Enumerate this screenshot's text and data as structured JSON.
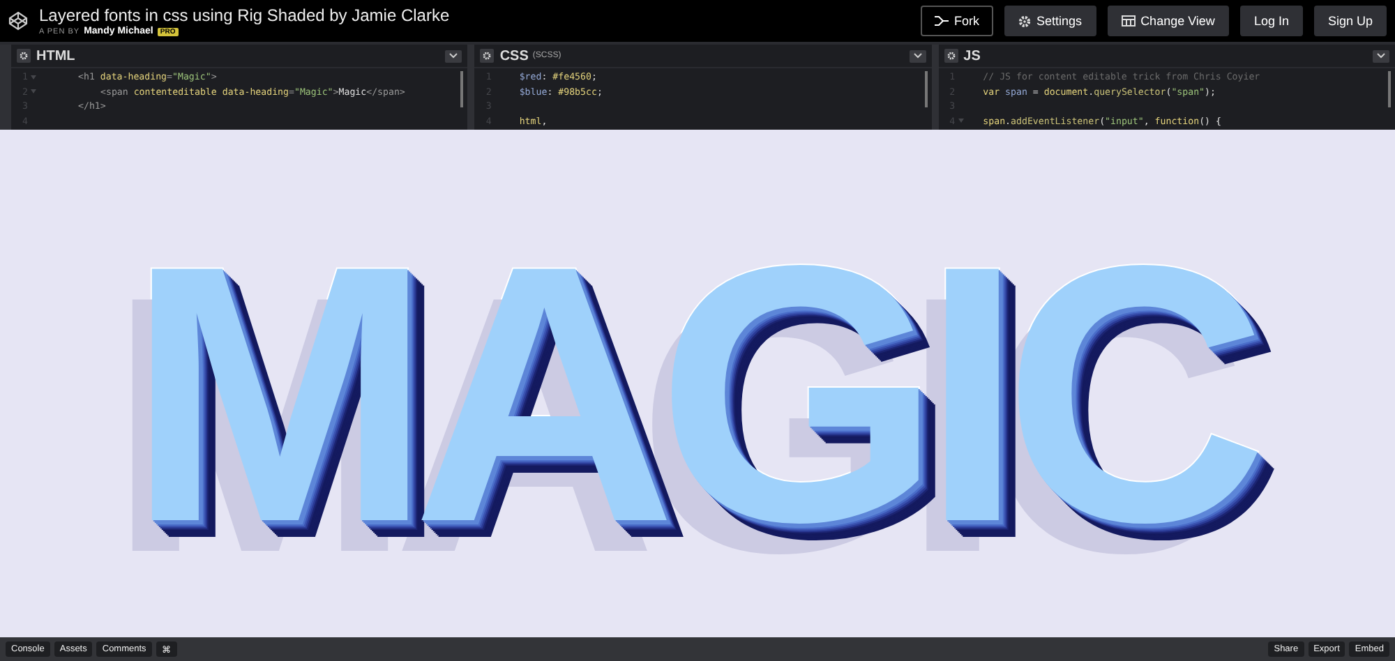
{
  "header": {
    "title": "Layered fonts in css using Rig Shaded by Jamie Clarke",
    "byline": "A PEN BY",
    "author": "Mandy Michael",
    "badge": "PRO",
    "buttons": [
      {
        "label": "Fork",
        "kind": "fork"
      },
      {
        "label": "Settings",
        "kind": "settings"
      },
      {
        "label": "Change View",
        "kind": "view"
      },
      {
        "label": "Log In",
        "kind": "plain"
      },
      {
        "label": "Sign Up",
        "kind": "plain"
      }
    ]
  },
  "editors": [
    {
      "title": "HTML",
      "lines": [
        {
          "number": "1",
          "fold": true,
          "kind": "outer",
          "tokens": [
            {
              "kind": "tag",
              "text": "<h1 "
            },
            {
              "kind": "attr",
              "text": "data-heading"
            },
            {
              "kind": "tag",
              "text": "="
            },
            {
              "kind": "string",
              "text": "\"Magic\""
            },
            {
              "kind": "tag",
              "text": ">"
            }
          ]
        },
        {
          "number": "2",
          "fold": true,
          "kind": "inner",
          "tokens": [
            {
              "kind": "tag",
              "text": "<span "
            },
            {
              "kind": "attr",
              "text": "contenteditable data-heading"
            },
            {
              "kind": "tag",
              "text": "="
            },
            {
              "kind": "string",
              "text": "\"Magic\""
            },
            {
              "kind": "tag",
              "text": ">"
            },
            {
              "kind": "plain",
              "text": "Magic"
            },
            {
              "kind": "tag",
              "text": "</span>"
            }
          ]
        },
        {
          "number": "3",
          "fold": false,
          "kind": "outer",
          "tokens": [
            {
              "kind": "tag",
              "text": "</h1>"
            }
          ]
        },
        {
          "number": "4",
          "fold": false
        }
      ]
    },
    {
      "title": "CSS",
      "subtitle": "(SCSS)",
      "lines": [
        {
          "number": "1",
          "fold": false,
          "kind": "top",
          "tokens": [
            {
              "kind": "var",
              "text": "$red"
            },
            {
              "kind": "plain",
              "text": ": "
            },
            {
              "kind": "value",
              "text": "#fe4560"
            },
            {
              "kind": "plain",
              "text": ";"
            }
          ]
        },
        {
          "number": "2",
          "fold": false,
          "kind": "top",
          "tokens": [
            {
              "kind": "var",
              "text": "$blue"
            },
            {
              "kind": "plain",
              "text": ": "
            },
            {
              "kind": "value",
              "text": "#98b5cc"
            },
            {
              "kind": "plain",
              "text": ";"
            }
          ]
        },
        {
          "number": "3",
          "fold": false
        },
        {
          "number": "4",
          "fold": false,
          "kind": "top",
          "tokens": [
            {
              "kind": "attr",
              "text": "html"
            },
            {
              "kind": "plain",
              "text": ","
            }
          ]
        }
      ]
    },
    {
      "title": "JS",
      "lines": [
        {
          "number": "1",
          "fold": false,
          "kind": "top",
          "tokens": [
            {
              "kind": "comment",
              "text": "// JS for content editable trick from Chris Coyier"
            }
          ]
        },
        {
          "number": "2",
          "fold": false,
          "kind": "top",
          "tokens": [
            {
              "kind": "attr",
              "text": "var "
            },
            {
              "kind": "var",
              "text": "span"
            },
            {
              "kind": "plain",
              "text": " = "
            },
            {
              "kind": "attr",
              "text": "document"
            },
            {
              "kind": "plain",
              "text": "."
            },
            {
              "kind": "fn",
              "text": "querySelector"
            },
            {
              "kind": "plain",
              "text": "("
            },
            {
              "kind": "string",
              "text": "\"span\""
            },
            {
              "kind": "plain",
              "text": ");"
            }
          ]
        },
        {
          "number": "3",
          "fold": false
        },
        {
          "number": "4",
          "fold": true,
          "kind": "top",
          "tokens": [
            {
              "kind": "attr",
              "text": "span"
            },
            {
              "kind": "plain",
              "text": "."
            },
            {
              "kind": "fn",
              "text": "addEventListener"
            },
            {
              "kind": "plain",
              "text": "("
            },
            {
              "kind": "string",
              "text": "\"input\""
            },
            {
              "kind": "plain",
              "text": ", "
            },
            {
              "kind": "attr",
              "text": "function"
            },
            {
              "kind": "plain",
              "text": "() {"
            }
          ]
        }
      ]
    }
  ],
  "preview": {
    "heading": "MAGIC"
  },
  "footer": {
    "left": [
      "Console",
      "Assets",
      "Comments",
      "⌘"
    ],
    "right": [
      "Share",
      "Export",
      "Embed"
    ]
  }
}
